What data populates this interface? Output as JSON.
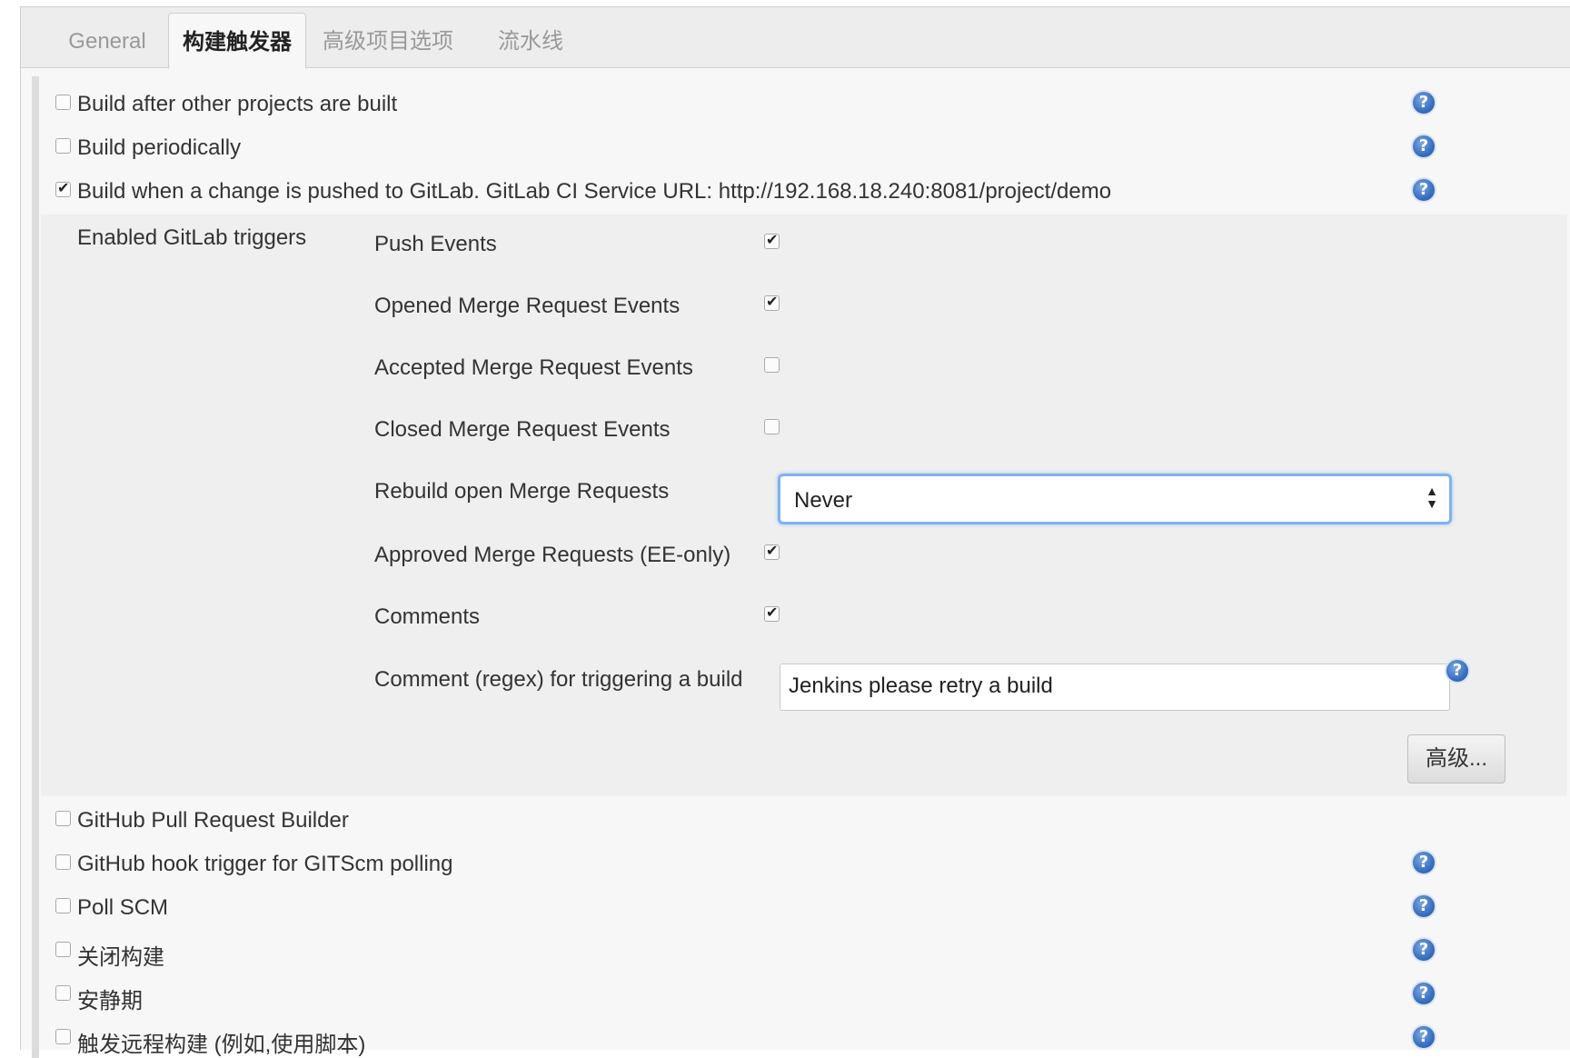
{
  "tabs": [
    "General",
    "构建触发器",
    "高级项目选项",
    "流水线"
  ],
  "triggers_top": [
    {
      "label": "Build after other projects are built",
      "checked": false,
      "help": true
    },
    {
      "label": "Build periodically",
      "checked": false,
      "help": true
    },
    {
      "label": "Build when a change is pushed to GitLab. GitLab CI Service URL: http://192.168.18.240:8081/project/demo",
      "checked": true,
      "help": true
    }
  ],
  "gitlab": {
    "section_label": "Enabled GitLab triggers",
    "push_events": {
      "label": "Push Events",
      "checked": true
    },
    "opened_mr": {
      "label": "Opened Merge Request Events",
      "checked": true
    },
    "accepted_mr": {
      "label": "Accepted Merge Request Events",
      "checked": false
    },
    "closed_mr": {
      "label": "Closed Merge Request Events",
      "checked": false
    },
    "rebuild": {
      "label": "Rebuild open Merge Requests",
      "value": "Never"
    },
    "approved_mr": {
      "label": "Approved Merge Requests (EE-only)",
      "checked": true
    },
    "comments": {
      "label": "Comments",
      "checked": true
    },
    "comment_regex": {
      "label": "Comment (regex) for triggering a build",
      "value": "Jenkins please retry a build"
    },
    "advanced_button": "高级..."
  },
  "triggers_bottom": [
    {
      "label": "GitHub Pull Request Builder",
      "checked": false,
      "help": false
    },
    {
      "label": "GitHub hook trigger for GITScm polling",
      "checked": false,
      "help": true
    },
    {
      "label": "Poll SCM",
      "checked": false,
      "help": true
    },
    {
      "label": "关闭构建",
      "checked": false,
      "help": true
    },
    {
      "label": "安静期",
      "checked": false,
      "help": true
    },
    {
      "label": "触发远程构建 (例如,使用脚本)",
      "checked": false,
      "help": true
    }
  ],
  "help_glyph": "?",
  "colors": {
    "accent_focus": "#7fb2ef",
    "help_blue": "#3a6fbf"
  }
}
